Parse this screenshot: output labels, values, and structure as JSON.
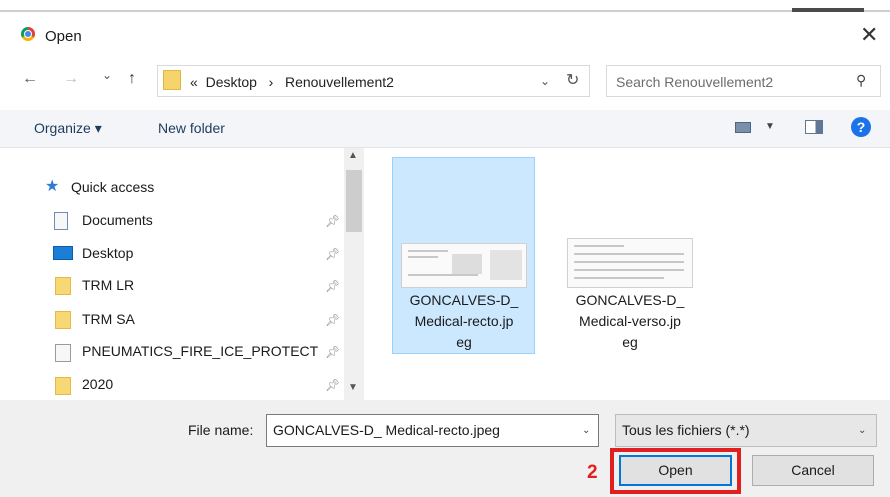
{
  "window": {
    "title": "Open",
    "close_label": "✕"
  },
  "nav": {
    "back": "←",
    "forward": "→",
    "history": "⌄",
    "up": "↑",
    "breadcrumb": [
      "Desktop",
      "Renouvellement2"
    ],
    "breadcrumb_prefix": "«",
    "breadcrumb_sep": "›",
    "search_placeholder": "Search Renouvellement2"
  },
  "toolbar": {
    "organize": "Organize ▾",
    "new_folder": "New folder",
    "help": "?"
  },
  "sidebar": {
    "items": [
      {
        "label": "Quick access",
        "icon": "star-icon"
      },
      {
        "label": "Documents",
        "icon": "document-icon",
        "pinned": true
      },
      {
        "label": "Desktop",
        "icon": "desktop-icon",
        "pinned": true
      },
      {
        "label": "TRM LR",
        "icon": "folder-icon",
        "pinned": true
      },
      {
        "label": "TRM SA",
        "icon": "folder-icon",
        "pinned": true
      },
      {
        "label": "PNEUMATICS_FIRE_ICE_PROTECT",
        "icon": "shortcut-icon",
        "pinned": true
      },
      {
        "label": "2020",
        "icon": "folder-icon",
        "pinned": true
      }
    ]
  },
  "files": [
    {
      "line1": "GONCALVES-D_",
      "line2": "Medical-recto.jp",
      "line3": "eg",
      "selected": true
    },
    {
      "line1": "GONCALVES-D_",
      "line2": "Medical-verso.jp",
      "line3": "eg",
      "selected": false
    }
  ],
  "footer": {
    "filename_label": "File name:",
    "filename_value": "GONCALVES-D_ Medical-recto.jpeg",
    "filter_value": "Tous les fichiers (*.*)",
    "open_label": "Open",
    "cancel_label": "Cancel",
    "step_marker": "2"
  },
  "colors": {
    "selection": "#cce8ff",
    "highlight": "#e02020",
    "accent": "#0078d7"
  }
}
